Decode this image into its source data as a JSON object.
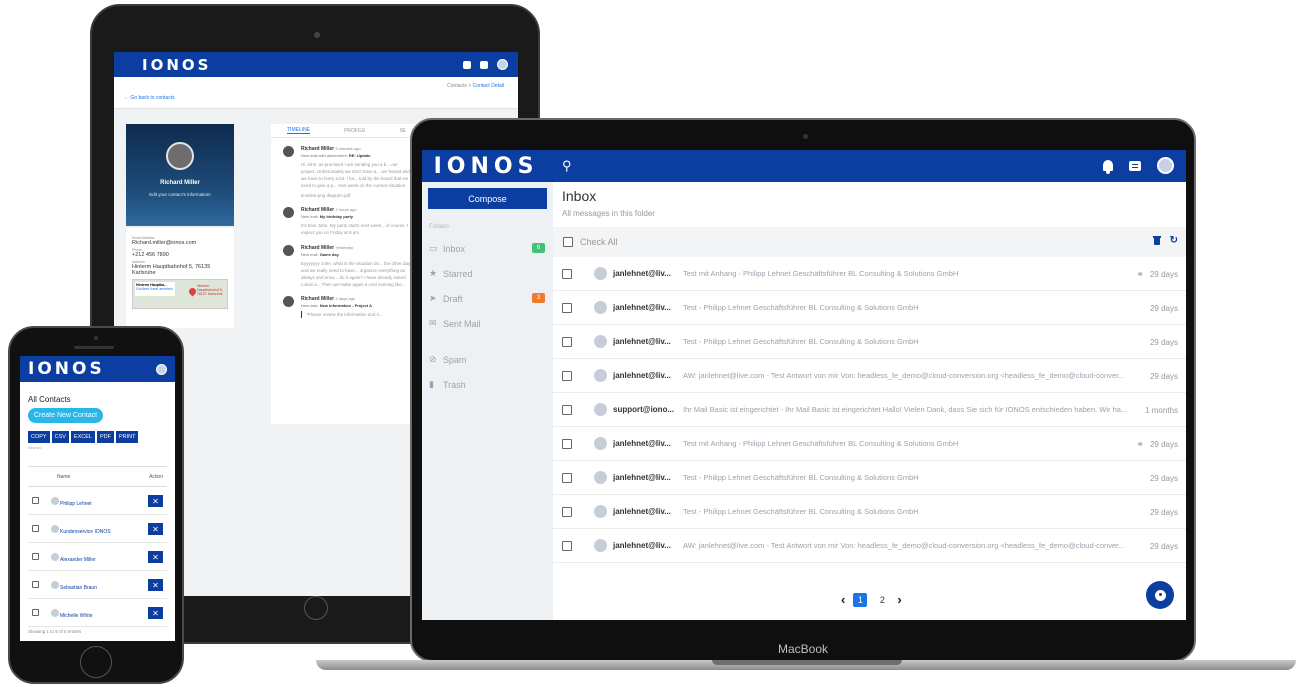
{
  "brand": "IONOS",
  "tablet": {
    "breadcrumb": {
      "parent": "Contacts",
      "separator": ">",
      "current": "Contact Detail"
    },
    "back_link": "← Go back to contacts",
    "contact_name": "Richard Miller",
    "edit_text": "Edit your contact's information!",
    "email_label": "Email Address",
    "email": "Richard.miller@ionos.com",
    "phone_label": "Phone",
    "phone": "+212 456 7890",
    "address_label": "Address",
    "address": "Hinterm Hauptbahnhof 5, 76135 Karlsruhe",
    "map_title": "Hinterm Hauptba...",
    "map_link": "Größere Karte ansehen",
    "map_pin_label": "Hinterm Hauptbahnhof 5, 76137 Karlsruhe",
    "tabs": [
      "TIMELINE",
      "PROFILE",
      "SE"
    ],
    "timeline": [
      {
        "author": "Richard Miller",
        "time": "5 minutes ago",
        "title_prefix": "New mail with attachment:",
        "title": "RE: Update",
        "body": "Hi John, as promised I am sending you a b... our project. Unfortunately we don't have a... we feared and we have to hurry a bit. I ha... told by the board that we need to give a p... next week on the current situation.",
        "attachments": "timeline.png   diagram.pdf"
      },
      {
        "author": "Richard Miller",
        "time": "2 hours ago",
        "title_prefix": "New mail:",
        "title": "My birthday party",
        "body": "It's time John. My party starts next week... of course. I expect you on Friday at 8 pm",
        "attachments": ""
      },
      {
        "author": "Richard Miller",
        "time": "Yesterday",
        "title_prefix": "New mail:",
        "title": "Game day",
        "body": "Eyyyyyyy John, what is the situation do... the other day and we really need to have... organize everything as always and ensu... do it again? I have already asked Lukas a... Then we make again a cool evening like...",
        "attachments": ""
      },
      {
        "author": "Richard Miller",
        "time": "2 days ago",
        "title_prefix": "New task:",
        "title": "New information - Project A",
        "body": "\"Please review the information and s...",
        "attachments": ""
      }
    ]
  },
  "laptop": {
    "label": "MacBook",
    "compose": "Compose",
    "folders_label": "Folders",
    "folders": [
      {
        "icon": "inbox-icon",
        "glyph": "▭",
        "label": "Inbox",
        "badge": "6",
        "badge_color": "#3fc17a"
      },
      {
        "icon": "star-icon",
        "glyph": "★",
        "label": "Starred",
        "badge": "",
        "badge_color": ""
      },
      {
        "icon": "send-icon",
        "glyph": "➤",
        "label": "Draft",
        "badge": "3",
        "badge_color": "#f07b2b"
      },
      {
        "icon": "mail-icon",
        "glyph": "✉",
        "label": "Sent Mail",
        "badge": "",
        "badge_color": ""
      },
      {
        "icon": "spam-icon",
        "glyph": "⊘",
        "label": "Spam",
        "badge": "",
        "badge_color": ""
      },
      {
        "icon": "trash-icon",
        "glyph": "▮",
        "label": "Trash",
        "badge": "",
        "badge_color": ""
      }
    ],
    "inbox_title": "Inbox",
    "inbox_subtitle": "All messages in this folder",
    "check_all": "Check All",
    "emails": [
      {
        "from": "janlehnet@liv...",
        "subject": "Test mit Anhang - Philipp Lehnet Geschäftsführer BL Consulting & Solutions GmbH",
        "attachment": true,
        "date": "29 days"
      },
      {
        "from": "janlehnet@liv...",
        "subject": "Test - Philipp Lehnet Geschäftsführer BL Consulting & Solutions GmbH",
        "attachment": false,
        "date": "29 days"
      },
      {
        "from": "janlehnet@liv...",
        "subject": "Test - Philipp Lehnet Geschäftsführer BL Consulting & Solutions GmbH",
        "attachment": false,
        "date": "29 days"
      },
      {
        "from": "janlehnet@liv...",
        "subject": "AW: janlehnet@live.com - Test Antwort von mir Von: headless_fe_demo@cloud-conversion.org <headless_fe_demo@cloud-conver...",
        "attachment": false,
        "date": "29 days"
      },
      {
        "from": "support@iono...",
        "subject": "Ihr Mail Basic ist eingerichtet - Ihr Mail Basic ist eingerichtet Hallo! Vielen Dank, dass Sie sich für IONOS entschieden haben. Wir ha...",
        "attachment": false,
        "date": "1 months"
      },
      {
        "from": "janlehnet@liv...",
        "subject": "Test mit Anhang - Philipp Lehnet Geschäftsführer BL Consulting & Solutions GmbH",
        "attachment": true,
        "date": "29 days"
      },
      {
        "from": "janlehnet@liv...",
        "subject": "Test - Philipp Lehnet Geschäftsführer BL Consulting & Solutions GmbH",
        "attachment": false,
        "date": "29 days"
      },
      {
        "from": "janlehnet@liv...",
        "subject": "Test - Philipp Lehnet Geschäftsführer BL Consulting & Solutions GmbH",
        "attachment": false,
        "date": "29 days"
      },
      {
        "from": "janlehnet@liv...",
        "subject": "AW: janlehnet@live.com - Test Antwort von mir Von: headless_fe_demo@cloud-conversion.org <headless_fe_demo@cloud-conver...",
        "attachment": false,
        "date": "29 days"
      }
    ],
    "pagination": {
      "prev": "‹",
      "pages": [
        "1",
        "2"
      ],
      "active": "1",
      "next": "›"
    }
  },
  "phone": {
    "title": "All Contacts",
    "create_button": "Create New Contact",
    "exports": [
      "COPY",
      "CSV",
      "EXCEL",
      "PDF",
      "PRINT"
    ],
    "search_label": "Search:",
    "col_name": "Name",
    "col_action": "Action",
    "contacts": [
      "Philipp Lehnet",
      "Kundenservice IONOS",
      "Alexander Miller",
      "Sebastian Braun",
      "Michelle White"
    ],
    "footer": "Showing 1 to 5 of 5 entries"
  },
  "colors": {
    "brand_blue": "#0b3ea0",
    "accent_blue": "#1a73e8",
    "create_cyan": "#28b7e8"
  }
}
